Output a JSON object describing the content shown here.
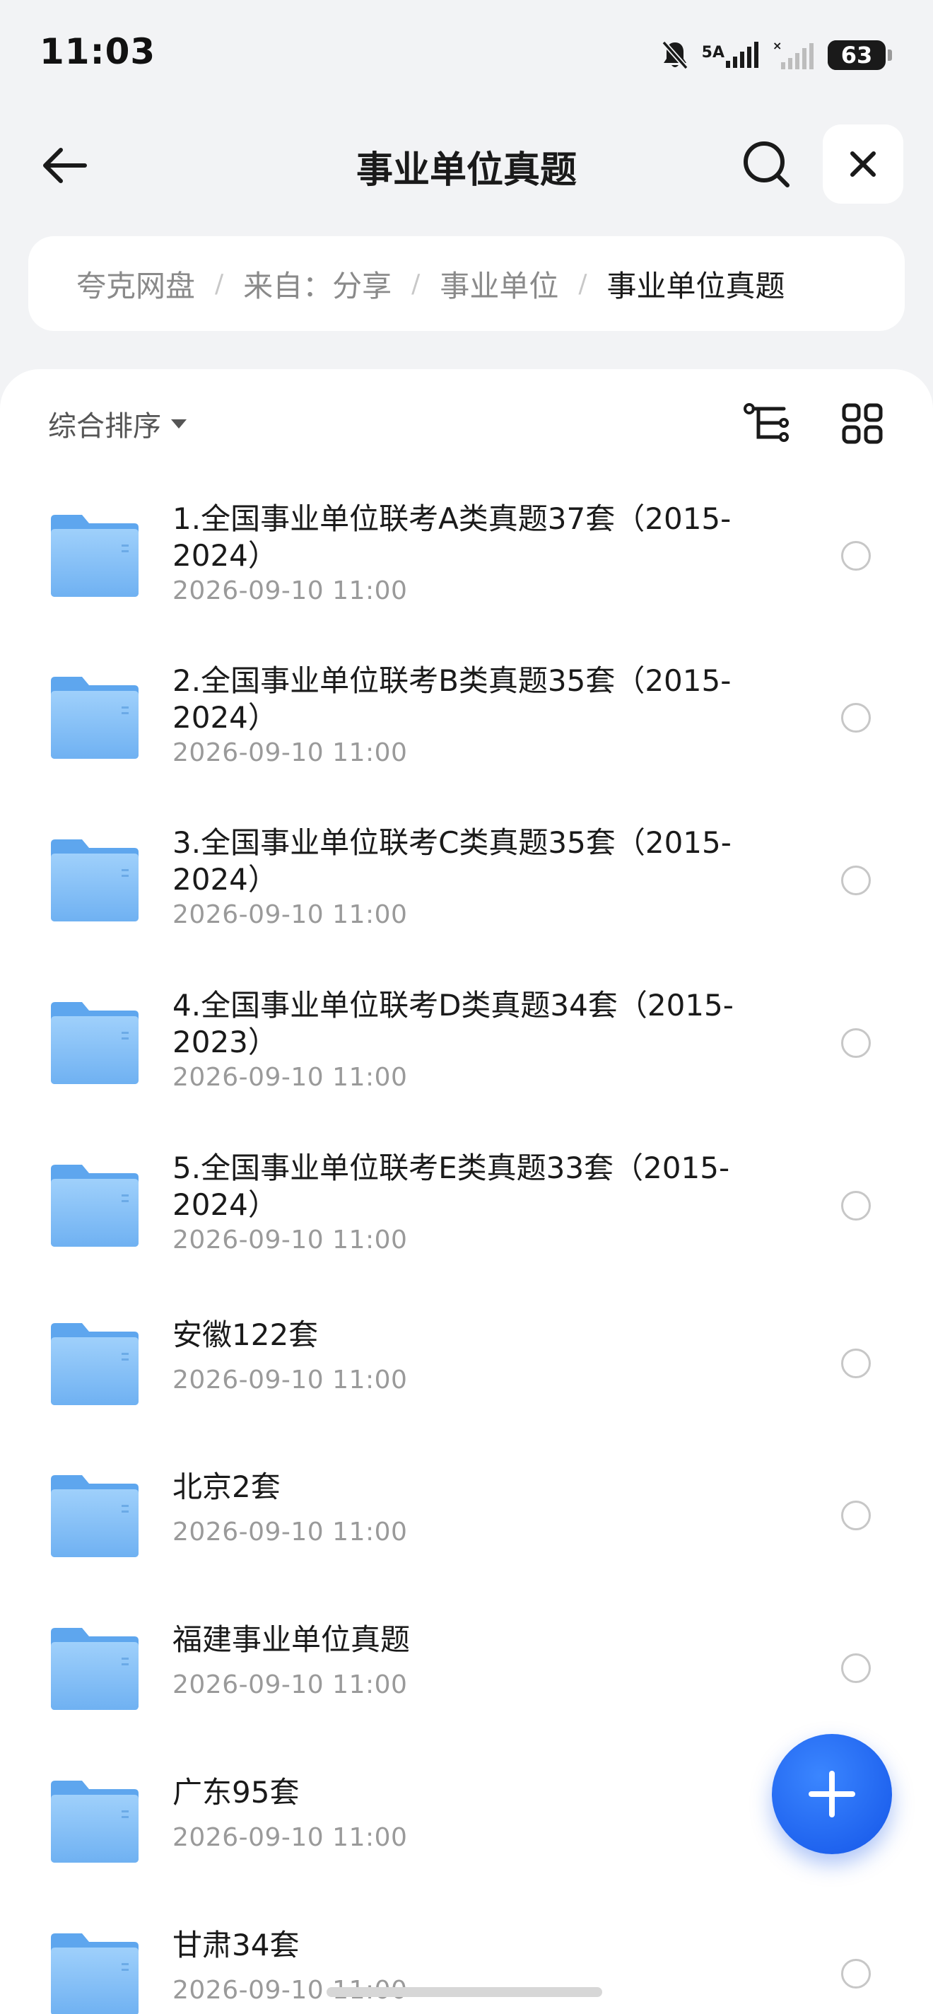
{
  "status_bar": {
    "time": "11:03",
    "network_label": "5A",
    "battery": "63",
    "battery_level": 0.63,
    "icons": [
      "bell-muted-icon",
      "signal-icon",
      "signal-no-sim-icon",
      "battery-icon"
    ]
  },
  "header": {
    "title": "事业单位真题",
    "back_icon": "arrow-left-icon",
    "search_icon": "search-icon",
    "close_icon": "close-icon"
  },
  "breadcrumb": {
    "separator": "/",
    "items": [
      "夸克网盘",
      "来自：分享",
      "事业单位",
      "事业单位真题"
    ]
  },
  "toolbar": {
    "sort_label": "综合排序",
    "tree_icon": "directory-tree-icon",
    "grid_icon": "grid-view-icon"
  },
  "files": [
    {
      "name": "1.全国事业单位联考A类真题37套（2015-2024）",
      "time": "2026-09-10 11:00"
    },
    {
      "name": "2.全国事业单位联考B类真题35套（2015-2024）",
      "time": "2026-09-10 11:00"
    },
    {
      "name": "3.全国事业单位联考C类真题35套（2015-2024）",
      "time": "2026-09-10 11:00"
    },
    {
      "name": "4.全国事业单位联考D类真题34套（2015-2023）",
      "time": "2026-09-10 11:00"
    },
    {
      "name": "5.全国事业单位联考E类真题33套（2015-2024）",
      "time": "2026-09-10 11:00"
    },
    {
      "name": "安徽122套",
      "time": "2026-09-10 11:00"
    },
    {
      "name": "北京2套",
      "time": "2026-09-10 11:00"
    },
    {
      "name": "福建事业单位真题",
      "time": "2026-09-10 11:00"
    },
    {
      "name": "广东95套",
      "time": "2026-09-10 11:00"
    },
    {
      "name": "甘肃34套",
      "time": "2026-09-10 11:00"
    }
  ],
  "fab_icon": "plus-icon",
  "colors": {
    "accent": "#1a5cf0",
    "folder": "#7ab8f5",
    "background": "#f2f3f5"
  }
}
